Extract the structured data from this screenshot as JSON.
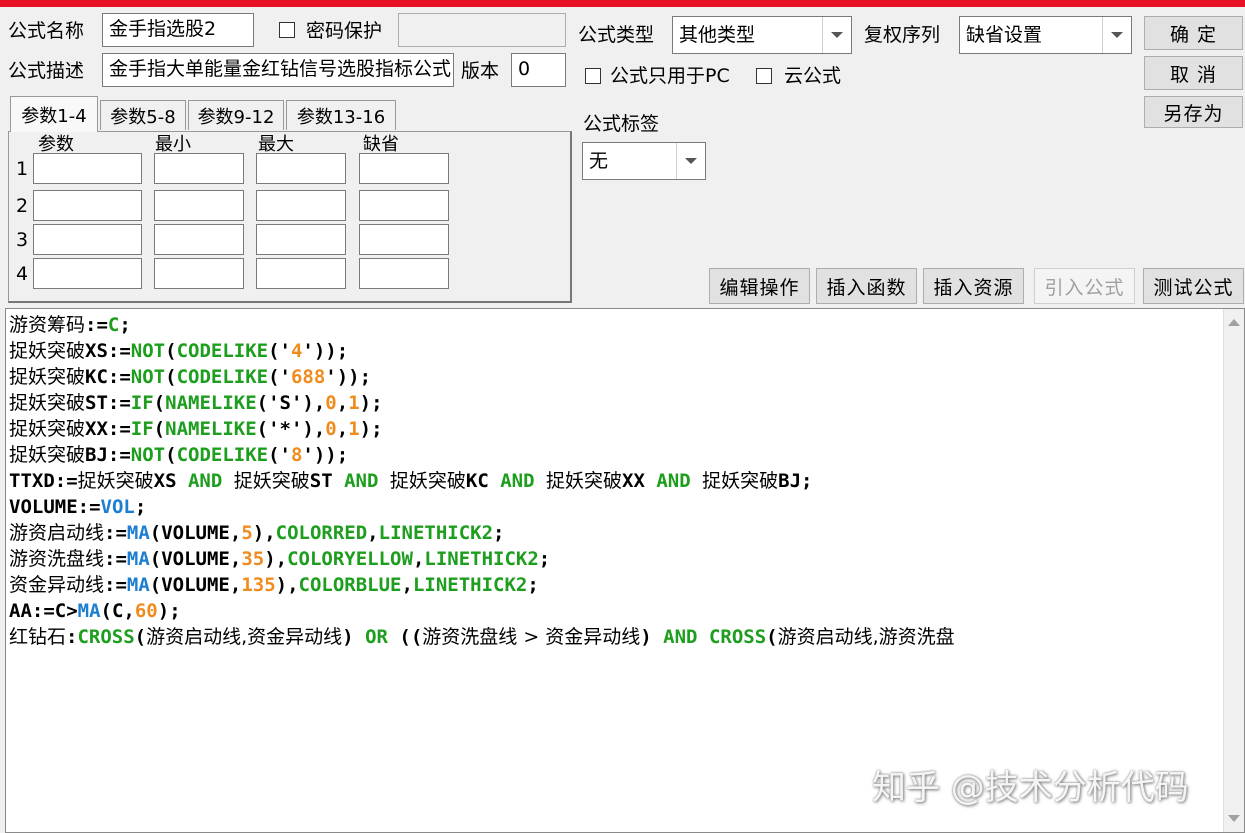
{
  "form": {
    "name_label": "公式名称",
    "name_value": "金手指选股2",
    "password_label": "密码保护",
    "desc_label": "公式描述",
    "desc_value": "金手指大单能量金红钻信号选股指标公式",
    "version_label": "版本",
    "version_value": "0",
    "type_label": "公式类型",
    "type_value": "其他类型",
    "fuquan_label": "复权序列",
    "fuquan_value": "缺省设置",
    "pc_only_label": "公式只用于PC",
    "cloud_label": "云公式",
    "tag_label": "公式标签",
    "tag_value": "无"
  },
  "buttons": {
    "ok": "确 定",
    "cancel": "取 消",
    "save_as": "另存为",
    "edit_ops": "编辑操作",
    "insert_func": "插入函数",
    "insert_res": "插入资源",
    "import_formula": "引入公式",
    "test_formula": "测试公式"
  },
  "params": {
    "tabs": [
      "参数1-4",
      "参数5-8",
      "参数9-12",
      "参数13-16"
    ],
    "headers": [
      "参数",
      "最小",
      "最大",
      "缺省"
    ],
    "rows": [
      "1",
      "2",
      "3",
      "4"
    ]
  },
  "code_lines": [
    [
      [
        "cn",
        "游资筹码"
      ],
      [
        "n",
        ":="
      ],
      [
        "f",
        "C"
      ],
      [
        "n",
        ";"
      ]
    ],
    [
      [
        "cn",
        "捉妖突破"
      ],
      [
        "n",
        "XS:="
      ],
      [
        "f",
        "NOT"
      ],
      [
        "n",
        "("
      ],
      [
        "f",
        "CODELIKE"
      ],
      [
        "n",
        "('"
      ],
      [
        "o",
        "4"
      ],
      [
        "n",
        "'));"
      ]
    ],
    [
      [
        "cn",
        "捉妖突破"
      ],
      [
        "n",
        "KC:="
      ],
      [
        "f",
        "NOT"
      ],
      [
        "n",
        "("
      ],
      [
        "f",
        "CODELIKE"
      ],
      [
        "n",
        "('"
      ],
      [
        "o",
        "688"
      ],
      [
        "n",
        "'));"
      ]
    ],
    [
      [
        "cn",
        "捉妖突破"
      ],
      [
        "n",
        "ST:="
      ],
      [
        "f",
        "IF"
      ],
      [
        "n",
        "("
      ],
      [
        "f",
        "NAMELIKE"
      ],
      [
        "n",
        "('S'),"
      ],
      [
        "o",
        "0"
      ],
      [
        "n",
        ","
      ],
      [
        "o",
        "1"
      ],
      [
        "n",
        ");"
      ]
    ],
    [
      [
        "cn",
        "捉妖突破"
      ],
      [
        "n",
        "XX:="
      ],
      [
        "f",
        "IF"
      ],
      [
        "n",
        "("
      ],
      [
        "f",
        "NAMELIKE"
      ],
      [
        "n",
        "('*'),"
      ],
      [
        "o",
        "0"
      ],
      [
        "n",
        ","
      ],
      [
        "o",
        "1"
      ],
      [
        "n",
        ");"
      ]
    ],
    [
      [
        "cn",
        "捉妖突破"
      ],
      [
        "n",
        "BJ:="
      ],
      [
        "f",
        "NOT"
      ],
      [
        "n",
        "("
      ],
      [
        "f",
        "CODELIKE"
      ],
      [
        "n",
        "('"
      ],
      [
        "o",
        "8"
      ],
      [
        "n",
        "'));"
      ]
    ],
    [
      [
        "n",
        "TTXD:="
      ],
      [
        "cn",
        "捉妖突破"
      ],
      [
        "n",
        "XS "
      ],
      [
        "f",
        "AND"
      ],
      [
        "n",
        " "
      ],
      [
        "cn",
        "捉妖突破"
      ],
      [
        "n",
        "ST "
      ],
      [
        "f",
        "AND"
      ],
      [
        "n",
        " "
      ],
      [
        "cn",
        "捉妖突破"
      ],
      [
        "n",
        "KC "
      ],
      [
        "f",
        "AND"
      ],
      [
        "n",
        " "
      ],
      [
        "cn",
        "捉妖突破"
      ],
      [
        "n",
        "XX "
      ],
      [
        "f",
        "AND"
      ],
      [
        "n",
        " "
      ],
      [
        "cn",
        "捉妖突破"
      ],
      [
        "n",
        "BJ;"
      ]
    ],
    [
      [
        "n",
        "VOLUME:="
      ],
      [
        "b",
        "VOL"
      ],
      [
        "n",
        ";"
      ]
    ],
    [
      [
        "cn",
        "游资启动线"
      ],
      [
        "n",
        ":="
      ],
      [
        "b",
        "MA"
      ],
      [
        "n",
        "(VOLUME,"
      ],
      [
        "o",
        "5"
      ],
      [
        "n",
        "),"
      ],
      [
        "f",
        "COLORRED"
      ],
      [
        "n",
        ","
      ],
      [
        "f",
        "LINETHICK2"
      ],
      [
        "n",
        ";"
      ]
    ],
    [
      [
        "cn",
        "游资洗盘线"
      ],
      [
        "n",
        ":="
      ],
      [
        "b",
        "MA"
      ],
      [
        "n",
        "(VOLUME,"
      ],
      [
        "o",
        "35"
      ],
      [
        "n",
        "),"
      ],
      [
        "f",
        "COLORYELLOW"
      ],
      [
        "n",
        ","
      ],
      [
        "f",
        "LINETHICK2"
      ],
      [
        "n",
        ";"
      ]
    ],
    [
      [
        "cn",
        "资金异动线"
      ],
      [
        "n",
        ":="
      ],
      [
        "b",
        "MA"
      ],
      [
        "n",
        "(VOLUME,"
      ],
      [
        "o",
        "135"
      ],
      [
        "n",
        "),"
      ],
      [
        "f",
        "COLORBLUE"
      ],
      [
        "n",
        ","
      ],
      [
        "f",
        "LINETHICK2"
      ],
      [
        "n",
        ";"
      ]
    ],
    [
      [
        "n",
        "AA:=C>"
      ],
      [
        "b",
        "MA"
      ],
      [
        "n",
        "(C,"
      ],
      [
        "o",
        "60"
      ],
      [
        "n",
        ");"
      ]
    ],
    [
      [
        "cn",
        "红钻石"
      ],
      [
        "n",
        ":"
      ],
      [
        "f",
        "CROSS"
      ],
      [
        "n",
        "("
      ],
      [
        "cn",
        "游资启动线,资金异动线"
      ],
      [
        "n",
        ") "
      ],
      [
        "f",
        "OR"
      ],
      [
        "n",
        " (("
      ],
      [
        "cn",
        "游资洗盘线 > 资金异动线"
      ],
      [
        "n",
        ") "
      ],
      [
        "f",
        "AND"
      ],
      [
        "n",
        " "
      ],
      [
        "f",
        "CROSS"
      ],
      [
        "n",
        "("
      ],
      [
        "cn",
        "游资启动线,游资洗盘"
      ]
    ]
  ],
  "watermark": "知乎 @技术分析代码"
}
